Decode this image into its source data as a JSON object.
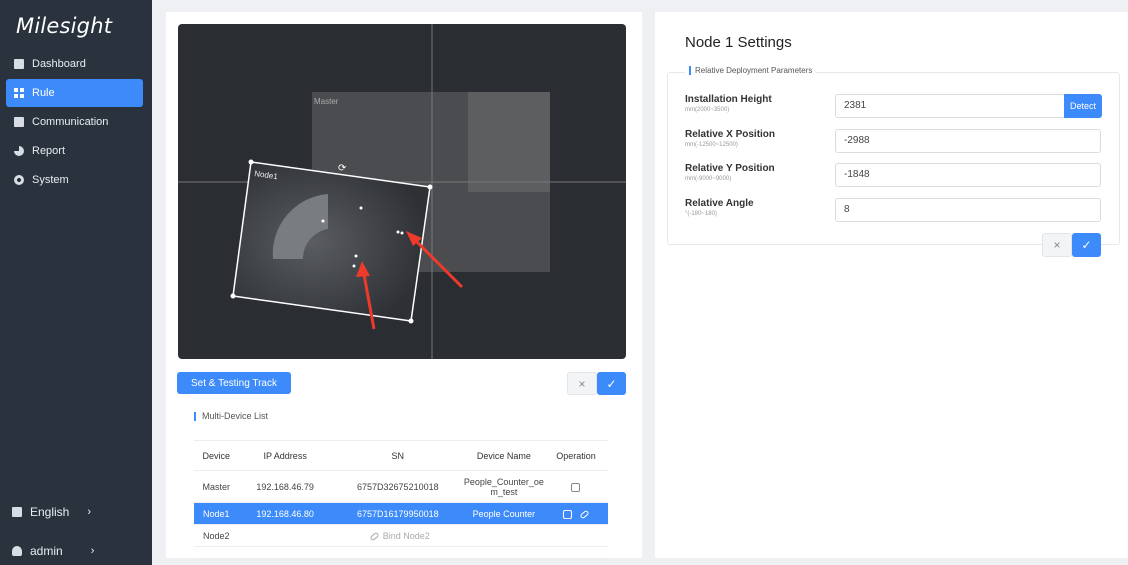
{
  "sidebar": {
    "logo": "Milesight",
    "items": [
      {
        "label": "Dashboard",
        "active": false
      },
      {
        "label": "Rule",
        "active": true
      },
      {
        "label": "Communication",
        "active": false
      },
      {
        "label": "Report",
        "active": false
      },
      {
        "label": "System",
        "active": false
      }
    ],
    "language": "English",
    "user": "admin"
  },
  "video": {
    "master_label": "Master",
    "node_label": "Node1"
  },
  "left": {
    "set_track_label": "Set & Testing Track",
    "list_title": "Multi-Device List",
    "table": {
      "headers": [
        "Device",
        "IP Address",
        "SN",
        "Device Name",
        "Operation"
      ],
      "rows": [
        {
          "device": "Master",
          "ip": "192.168.46.79",
          "sn": "6757D32675210018",
          "name": "People_Counter_oe m_test"
        },
        {
          "device": "Node1",
          "ip": "192.168.46.80",
          "sn": "6757D16179950018",
          "name": "People Counter"
        },
        {
          "device": "Node2",
          "ip": "",
          "sn": "",
          "name": "",
          "bind": "Bind Node2"
        }
      ]
    }
  },
  "settings": {
    "title": "Node 1 Settings",
    "group": "Relative Deployment Parameters",
    "fields": [
      {
        "label": "Installation Height",
        "hint": "mm(2000~3500)",
        "value": "2381"
      },
      {
        "label": "Relative X Position",
        "hint": "mm(-12500~12500)",
        "value": "-2988"
      },
      {
        "label": "Relative Y Position",
        "hint": "mm(-9000~9000)",
        "value": "-1848"
      },
      {
        "label": "Relative Angle",
        "hint": "°(-180~180)",
        "value": "8"
      }
    ],
    "detect_label": "Detect"
  },
  "colors": {
    "accent": "#3d8bfa",
    "sidebar": "#2a323d",
    "arrow": "#ee3a2b"
  }
}
